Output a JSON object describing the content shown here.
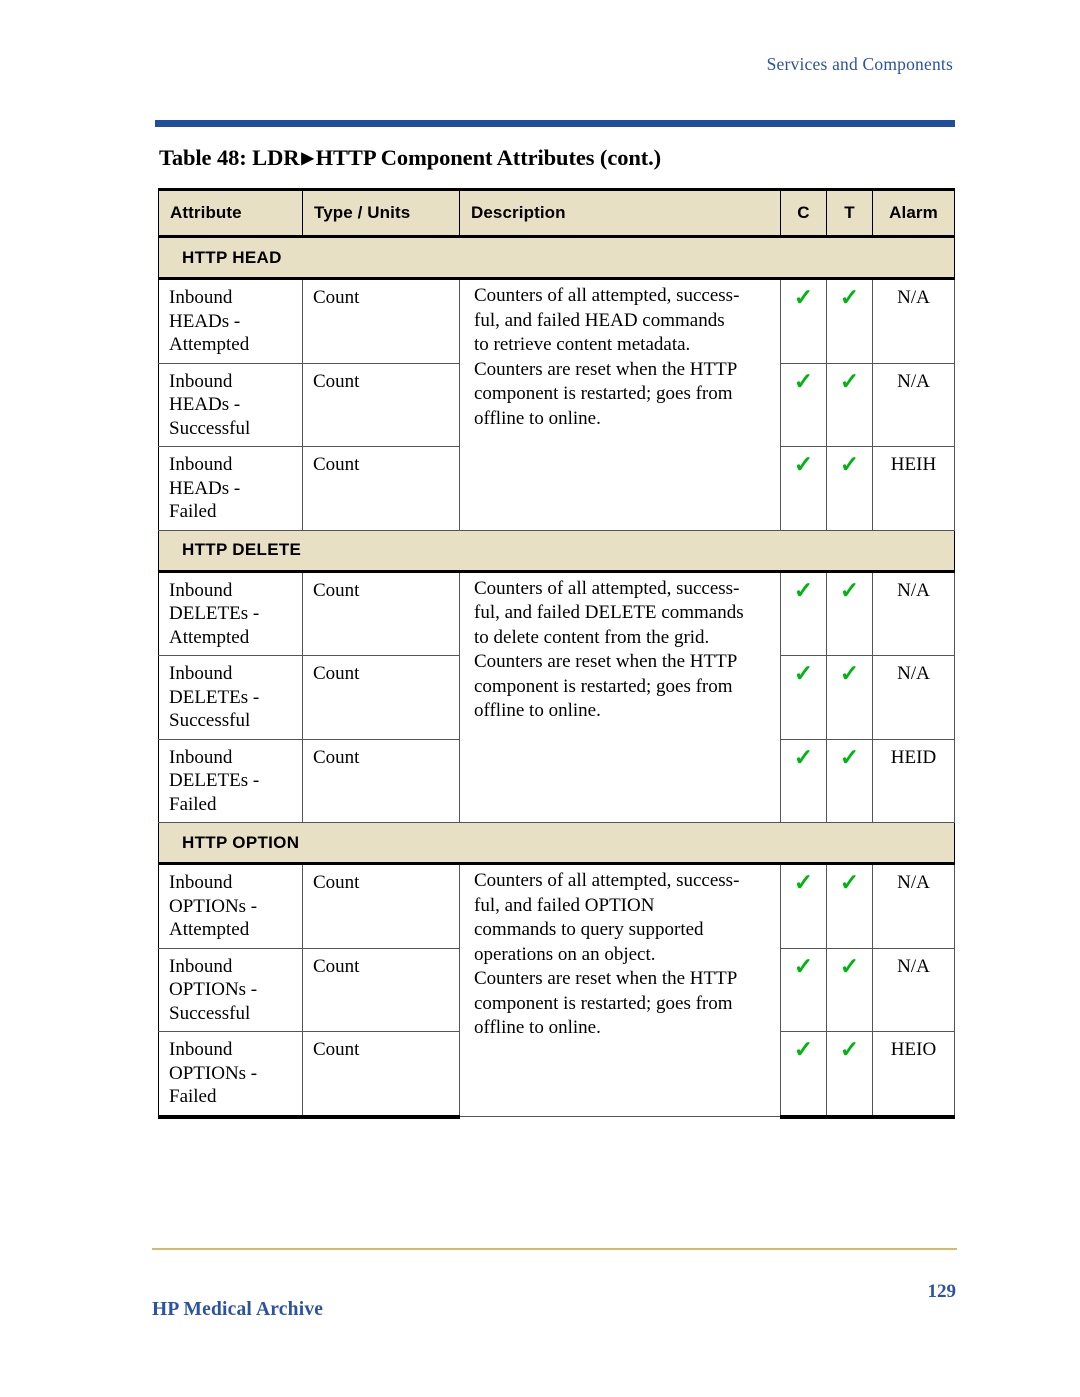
{
  "running_head": "Services and Components",
  "caption": {
    "prefix": "Table 48: LDR",
    "triangle": "▶",
    "suffix": "HTTP Component Attributes (cont.)"
  },
  "table": {
    "columns": [
      {
        "key": "attribute",
        "label": "Attribute"
      },
      {
        "key": "type_units",
        "label": "Type / Units"
      },
      {
        "key": "description",
        "label": "Description"
      },
      {
        "key": "c",
        "label": "C"
      },
      {
        "key": "t",
        "label": "T"
      },
      {
        "key": "alarm",
        "label": "Alarm"
      }
    ],
    "sections": [
      {
        "band_label": "HTTP HEAD",
        "description": "Counters of all attempted, success-\nful, and failed HEAD commands\nto retrieve content metadata.\nCounters are reset when the HTTP\ncomponent is restarted; goes from\noffline to online.",
        "rows": [
          {
            "attribute": "Inbound\nHEADs -\nAttempted",
            "type_units": "Count",
            "c": "✓",
            "t": "✓",
            "alarm": "N/A"
          },
          {
            "attribute": "Inbound\nHEADs -\nSuccessful",
            "type_units": "Count",
            "c": "✓",
            "t": "✓",
            "alarm": "N/A"
          },
          {
            "attribute": "Inbound\nHEADs -\nFailed",
            "type_units": "Count",
            "c": "✓",
            "t": "✓",
            "alarm": "HEIH"
          }
        ]
      },
      {
        "band_label": "HTTP DELETE",
        "description": "Counters of all attempted, success-\nful, and failed DELETE commands\nto delete content from the grid.\nCounters are reset when the HTTP\ncomponent is restarted; goes from\noffline to online.",
        "rows": [
          {
            "attribute": "Inbound\nDELETEs -\nAttempted",
            "type_units": "Count",
            "c": "✓",
            "t": "✓",
            "alarm": "N/A"
          },
          {
            "attribute": "Inbound\nDELETEs -\nSuccessful",
            "type_units": "Count",
            "c": "✓",
            "t": "✓",
            "alarm": "N/A"
          },
          {
            "attribute": "Inbound\nDELETEs -\nFailed",
            "type_units": "Count",
            "c": "✓",
            "t": "✓",
            "alarm": "HEID"
          }
        ]
      },
      {
        "band_label": "HTTP OPTION",
        "description": "Counters of all attempted, success-\nful, and failed OPTION\ncommands to query supported\noperations on an object.\nCounters are reset when the HTTP\ncomponent is restarted; goes from\noffline to online.",
        "rows": [
          {
            "attribute": "Inbound\nOPTIONs -\nAttempted",
            "type_units": "Count",
            "c": "✓",
            "t": "✓",
            "alarm": "N/A"
          },
          {
            "attribute": "Inbound\nOPTIONs -\nSuccessful",
            "type_units": "Count",
            "c": "✓",
            "t": "✓",
            "alarm": "N/A"
          },
          {
            "attribute": "Inbound\nOPTIONs -\nFailed",
            "type_units": "Count",
            "c": "✓",
            "t": "✓",
            "alarm": "HEIO"
          }
        ]
      }
    ]
  },
  "footer": {
    "brand": "HP Medical Archive",
    "page_number": "129"
  },
  "colors": {
    "rule_blue": "#1F4EA1",
    "header_beige": "#E8E0C5",
    "check_green": "#00B512",
    "brand_blue": "#2B52A4",
    "footer_rule": "#D9B866"
  }
}
